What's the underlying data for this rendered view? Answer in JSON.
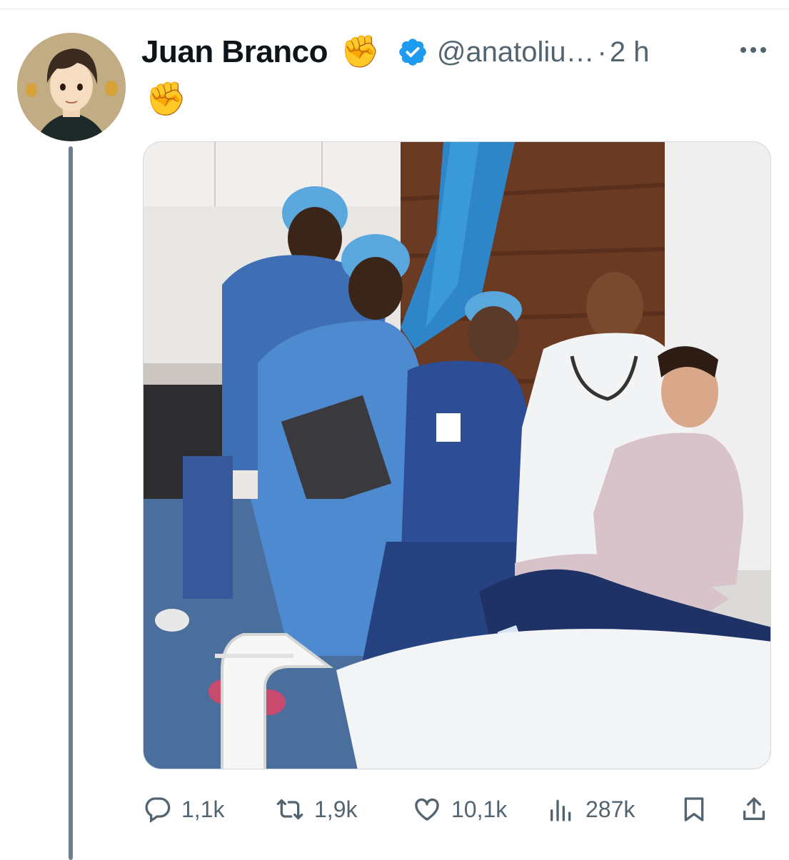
{
  "tweet": {
    "author_name": "Juan Branco",
    "name_emoji": "✊",
    "handle": "@anatoliu…",
    "separator": "·",
    "time": "2 h",
    "text": "✊"
  },
  "actions": {
    "replies": "1,1k",
    "retweets": "1,9k",
    "likes": "10,1k",
    "views": "287k"
  },
  "icons": {
    "verified": "verified-badge-icon",
    "more": "more-icon",
    "reply": "reply-icon",
    "retweet": "retweet-icon",
    "like": "heart-icon",
    "views": "views-icon",
    "bookmark": "bookmark-icon",
    "share": "share-icon"
  },
  "colors": {
    "verified": "#1d9bf0",
    "thread_line": "#707e8d",
    "action_gray": "#536471",
    "text": "#0f1419"
  }
}
